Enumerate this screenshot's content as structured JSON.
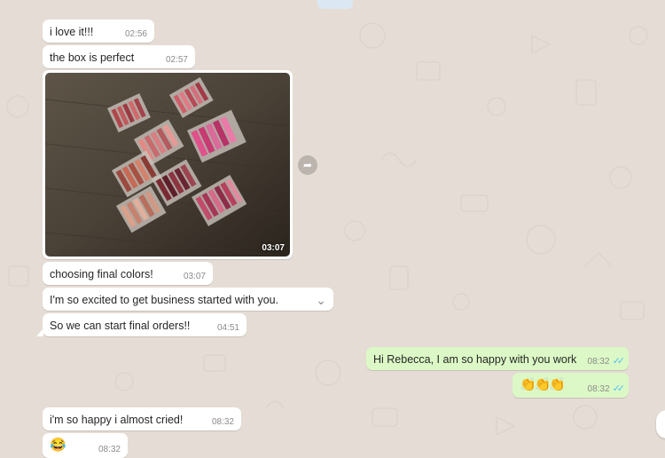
{
  "conversation": {
    "messages": [
      {
        "id": "m1",
        "direction": "in",
        "text": "i love it!!!",
        "time": "02:56"
      },
      {
        "id": "m2",
        "direction": "in",
        "text": "the box is perfect",
        "time": "02:57"
      },
      {
        "id": "m3",
        "direction": "in",
        "type": "image",
        "time": "03:07"
      },
      {
        "id": "m4",
        "direction": "in",
        "text": "choosing final colors!",
        "time": "03:07"
      },
      {
        "id": "m5",
        "direction": "in",
        "text": "I'm so excited to get business started with you.",
        "time": ""
      },
      {
        "id": "m6",
        "direction": "in",
        "text": "So we can start final orders!!",
        "time": "04:51"
      },
      {
        "id": "m7",
        "direction": "out",
        "text": "Hi Rebecca, I am so happy with you work",
        "time": "08:32",
        "status": "read"
      },
      {
        "id": "m8",
        "direction": "out",
        "text": "👏👏👏",
        "time": "08:32",
        "status": "read"
      },
      {
        "id": "m9",
        "direction": "in",
        "text": "i'm so happy i almost cried!",
        "time": "08:32"
      },
      {
        "id": "m10",
        "direction": "in",
        "text": "😂",
        "time": "08:32"
      }
    ]
  },
  "icons": {
    "forward": "forward-icon",
    "menu": "chevron-down-icon",
    "read_ticks": "double-check-icon"
  },
  "colors": {
    "background": "#e5ddd5",
    "incoming": "#ffffff",
    "outgoing": "#dcf8c6",
    "read_tick": "#4fc3f7"
  }
}
